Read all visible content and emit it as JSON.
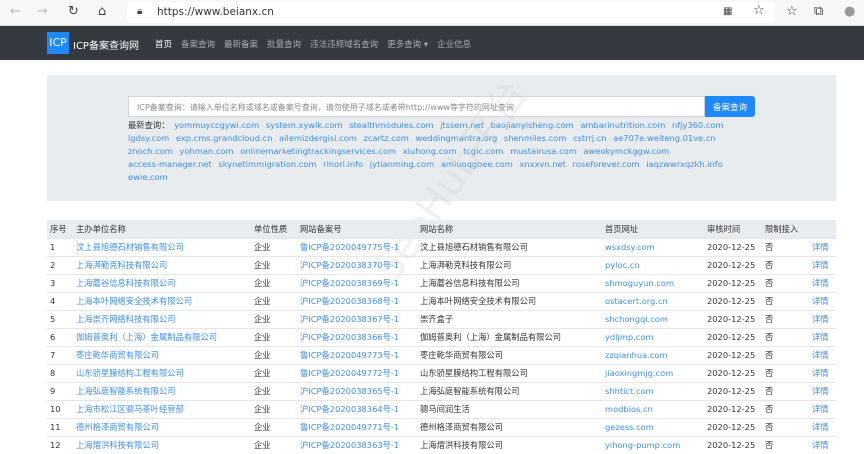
{
  "browser": {
    "url": "https://www.beianx.cn"
  },
  "nav": {
    "logo": "ICP",
    "brand": "ICP备案查询网",
    "items": [
      "首页",
      "备案查询",
      "最新备案",
      "批量查询",
      "违法违规域名查询",
      "更多查询 ▾",
      "企业信息"
    ]
  },
  "search": {
    "placeholder": "ICP备案查询：请输入单位名称或域名或备案号查询，请勿使用子域名或者带http://www等字符的网址查询",
    "button": "备案查询",
    "recent_label": "最新查询：",
    "recent": [
      "yommuyccgywi.com",
      "system.xywlk.com",
      "stealthmodules.com",
      "jtssem.net",
      "baojianyisheng.com",
      "ambarinutrition.com",
      "nfjy360.com",
      "lgdsy.com",
      "exp.cms.grandcloud.cn",
      "ailemizdergisi.com",
      "zcartz.com",
      "weddingmantra.org",
      "shenmiles.com",
      "cstrrj.cn",
      "ae707e.weiteng.01ve.cn",
      "znoch.com",
      "yohman.com",
      "onlinemarketingtrackingservices.com",
      "xiuhong.com",
      "tcgic.com",
      "mustairusa.com",
      "aweokymckggw.com",
      "access-manager.net",
      "skynetimmigration.com",
      "rinori.info",
      "jytianming.com",
      "amiuoqgoee.com",
      "xnxxvn.net",
      "roseforever.com",
      "iaqzwwrxqzkh.info",
      "ewie.com"
    ]
  },
  "table": {
    "headers": [
      "序号",
      "主办单位名称",
      "单位性质",
      "网站备案号",
      "网站名称",
      "首页网址",
      "审核时间",
      "限制接入",
      ""
    ],
    "rows": [
      [
        "1",
        "汶上县旭德石材销售有限公司",
        "企业",
        "鲁ICP备2020049775号-1",
        "汶上县旭德石材销售有限公司",
        "wsxdsy.com",
        "2020-12-25",
        "否",
        "详情"
      ],
      [
        "2",
        "上海湃勒克科技有限公司",
        "企业",
        "沪ICP备2020038370号-1",
        "上海湃勒克科技有限公司",
        "pyloc.cn",
        "2020-12-25",
        "否",
        "详情"
      ],
      [
        "3",
        "上海蘑谷信息科技有限公司",
        "企业",
        "沪ICP备2020038369号-1",
        "上海蘑谷信息科技有限公司",
        "shmoguyun.com",
        "2020-12-25",
        "否",
        "详情"
      ],
      [
        "4",
        "上海本叶网络安全技术有限公司",
        "企业",
        "沪ICP备2020038368号-1",
        "上海本叶网络安全技术有限公司",
        "ostacert.org.cn",
        "2020-12-25",
        "否",
        "详情"
      ],
      [
        "5",
        "上海崇齐网络科技有限公司",
        "企业",
        "沪ICP备2020038367号-1",
        "崇齐盒子",
        "shchongqi.com",
        "2020-12-25",
        "否",
        "详情"
      ],
      [
        "6",
        "伽姆普奥利（上海）金属制品有限公司",
        "企业",
        "沪ICP备2020038366号-1",
        "伽姆普奥利（上海）金属制品有限公司",
        "ydljmp.com",
        "2020-12-25",
        "否",
        "详情"
      ],
      [
        "7",
        "枣庄乾华商贸有限公司",
        "企业",
        "鲁ICP备2020049773号-1",
        "枣庄乾华商贸有限公司",
        "zzqianhua.com",
        "2020-12-25",
        "否",
        "详情"
      ],
      [
        "8",
        "山东骄星膜结构工程有限公司",
        "企业",
        "鲁ICP备2020049772号-1",
        "山东骄星膜结构工程有限公司",
        "jiaoxingmjg.com",
        "2020-12-25",
        "否",
        "详情"
      ],
      [
        "9",
        "上海弘庭智能系统有限公司",
        "企业",
        "沪ICP备2020038365号-1",
        "上海弘庭智能系统有限公司",
        "shhtict.com",
        "2020-12-25",
        "否",
        "详情"
      ],
      [
        "10",
        "上海市松江区骢马茶叶经营部",
        "企业",
        "沪ICP备2020038364号-1",
        "骢马间润生活",
        "modbios.cn",
        "2020-12-25",
        "否",
        "详情"
      ],
      [
        "11",
        "德州格泽商贸有限公司",
        "企业",
        "鲁ICP备2020049771号-1",
        "德州格泽商贸有限公司",
        "gezess.com",
        "2020-12-25",
        "否",
        "详情"
      ],
      [
        "12",
        "上海熠洪科技有限公司",
        "企业",
        "沪ICP备2020038363号-1",
        "上海熠洪科技有限公司",
        "yihong-pump.com",
        "2020-12-25",
        "否",
        "详情"
      ]
    ]
  }
}
